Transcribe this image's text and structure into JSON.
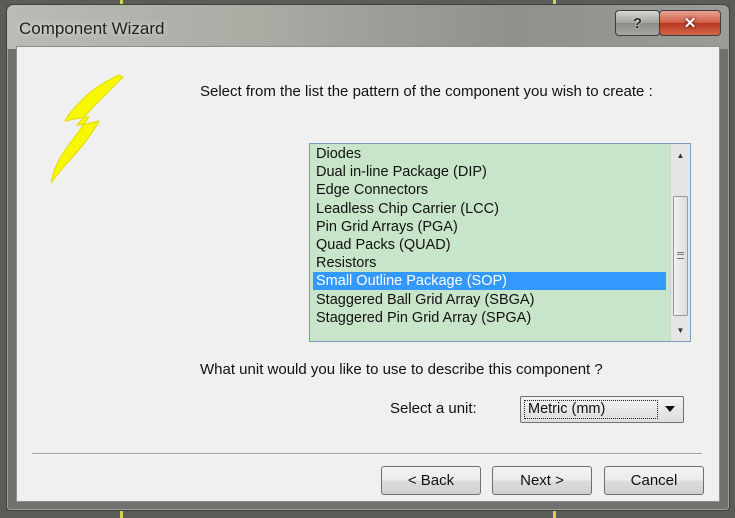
{
  "window": {
    "title": "Component Wizard"
  },
  "titlebar": {
    "help_label": "?",
    "close_label": "✕"
  },
  "wizard": {
    "prompt": "Select from the list the pattern of the component you wish to create :",
    "patterns": [
      "Diodes",
      "Dual in-line Package (DIP)",
      "Edge Connectors",
      "Leadless Chip Carrier (LCC)",
      "Pin Grid Arrays (PGA)",
      "Quad Packs (QUAD)",
      "Resistors",
      "Small Outline Package (SOP)",
      "Staggered Ball Grid Array (SBGA)",
      "Staggered Pin Grid Array (SPGA)"
    ],
    "selected_pattern": "Small Outline Package (SOP)",
    "unit_question": "What unit would you like to use to describe this component ?",
    "unit_label": "Select a unit:",
    "unit_value": "Metric (mm)"
  },
  "buttons": {
    "back": "< Back",
    "next": "Next >",
    "cancel": "Cancel"
  },
  "colors": {
    "list_bg": "#c9e5c9",
    "selection": "#3399ff",
    "close": "#c7442a",
    "bolt": "#f7f700"
  },
  "icons": {
    "wizard_logo": "lightning-bolt-icon",
    "scroll_up": "arrow-up-icon",
    "scroll_down": "arrow-down-icon",
    "dropdown": "chevron-down-icon"
  }
}
